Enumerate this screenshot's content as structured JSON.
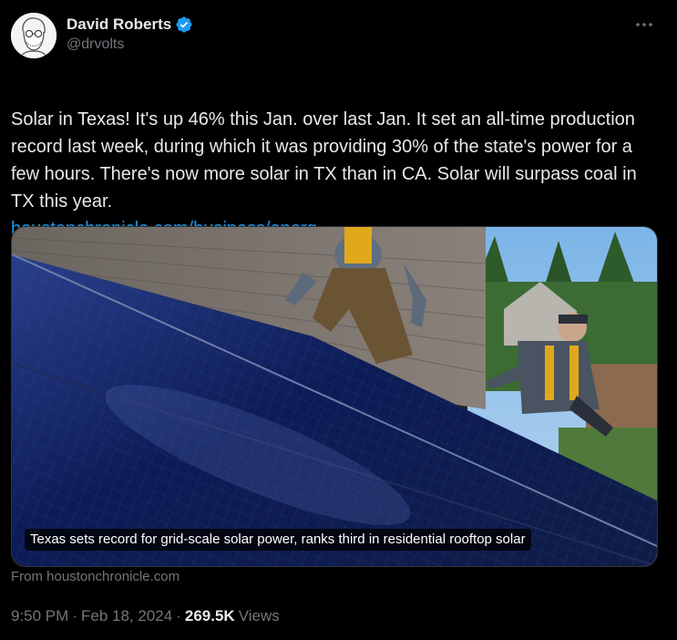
{
  "author": {
    "display_name": "David Roberts",
    "handle": "@drvolts",
    "verified": true
  },
  "tweet": {
    "text": "Solar in Texas! It's up 46% this Jan. over last Jan. It set an all-time production record last week, during which it was providing 30% of the state's power for a few hours. There's now more solar in TX than in CA. Solar will surpass coal in TX this year.",
    "link_text": "houstonchronicle.com/business/energ…"
  },
  "card": {
    "headline": "Texas sets record for grid-scale solar power, ranks third in residential rooftop solar",
    "source": "From houstonchronicle.com"
  },
  "meta": {
    "time": "9:50 PM",
    "separator": "·",
    "date": "Feb 18, 2024",
    "separator2": "·",
    "views_count": "269.5K",
    "views_label": "Views"
  },
  "icons": {
    "verified": "verified-badge-icon",
    "more": "more-options-icon"
  },
  "colors": {
    "background": "#000000",
    "text": "#e7e9ea",
    "secondary": "#71767b",
    "link": "#1d9bf0",
    "verified": "#1d9bf0"
  }
}
